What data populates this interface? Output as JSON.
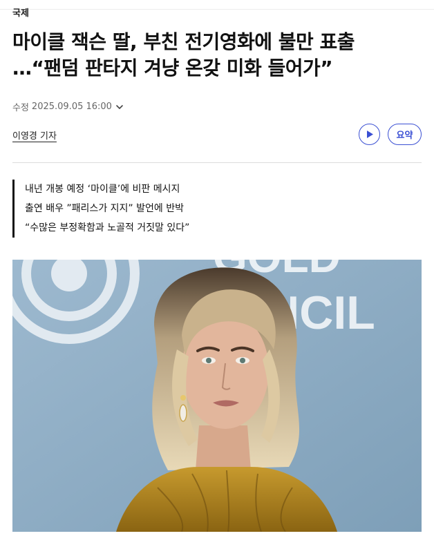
{
  "section": "국제",
  "headline": {
    "line1": "마이클 잭슨 딸, 부친 전기영화에 불만 표출",
    "line2": "…“팬덤 판타지 겨냥 온갖 미화 들어가”"
  },
  "meta": {
    "label": "수정",
    "timestamp": "2025.09.05 16:00"
  },
  "byline": "이영경 기자",
  "actions": {
    "summary_label": "요약"
  },
  "subheads": [
    "내년 개봉 예정 ‘마이클’에 비판 메시지",
    "출연 배우 ”패리스가 지지” 발언에 반박",
    "“수많은 부정확함과 노골적 거짓말 있다”"
  ],
  "photo": {
    "backdrop_text_line1": "GOLD",
    "backdrop_text_line2": "COUNCIL"
  },
  "colors": {
    "accent": "#3a4fd3",
    "backdrop": "#8fb0c8"
  }
}
